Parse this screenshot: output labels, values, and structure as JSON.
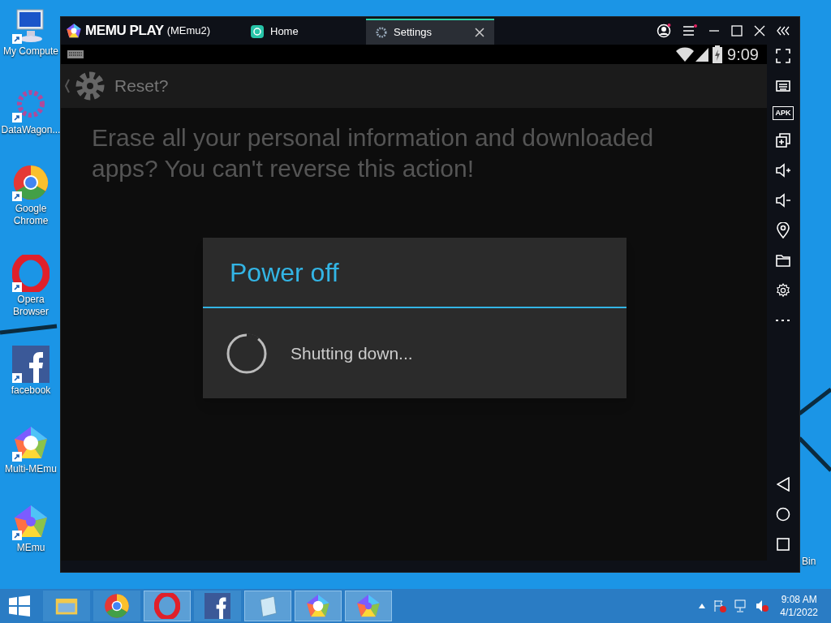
{
  "desktop_icons": [
    {
      "kind": "computer",
      "label": "My Compute"
    },
    {
      "kind": "datawagon",
      "label": "DataWagon..."
    },
    {
      "kind": "chrome",
      "label": "Google Chrome"
    },
    {
      "kind": "opera",
      "label": "Opera Browser"
    },
    {
      "kind": "facebook",
      "label": "facebook"
    },
    {
      "kind": "multimemu",
      "label": "Multi-MEmu"
    },
    {
      "kind": "memu",
      "label": "MEmu"
    }
  ],
  "right_desktop_icon": {
    "label": "Bin"
  },
  "window": {
    "logo": "MEMU PLAY",
    "instance": "(MEmu2)",
    "tabs": [
      {
        "label": "Home",
        "selected": false,
        "kind": "home"
      },
      {
        "label": "Settings",
        "selected": true,
        "kind": "settings"
      }
    ],
    "status_bar": {
      "time": "9:09"
    },
    "side_toolbar": [
      {
        "kind": "fullscreen"
      },
      {
        "kind": "keyboard"
      },
      {
        "kind": "apk",
        "label": "APK"
      },
      {
        "kind": "multi"
      },
      {
        "kind": "volup"
      },
      {
        "kind": "voldown"
      },
      {
        "kind": "location"
      },
      {
        "kind": "folder"
      },
      {
        "kind": "settings"
      },
      {
        "kind": "more"
      }
    ],
    "nav_buttons": [
      {
        "kind": "back"
      },
      {
        "kind": "home"
      },
      {
        "kind": "recent"
      }
    ]
  },
  "screen": {
    "action_bar_title": "Reset?",
    "message": "Erase all your personal information and downloaded apps? You can't reverse this action!",
    "dialog": {
      "title": "Power off",
      "message": "Shutting down..."
    }
  },
  "taskbar": {
    "apps": [
      {
        "kind": "explorer",
        "running": false
      },
      {
        "kind": "chrome",
        "running": false
      },
      {
        "kind": "opera",
        "running": true
      },
      {
        "kind": "facebook",
        "running": false
      },
      {
        "kind": "notepad",
        "running": true
      },
      {
        "kind": "multimemu",
        "running": true
      },
      {
        "kind": "memu",
        "running": true
      }
    ],
    "time": "9:08 AM",
    "date": "4/1/2022"
  }
}
